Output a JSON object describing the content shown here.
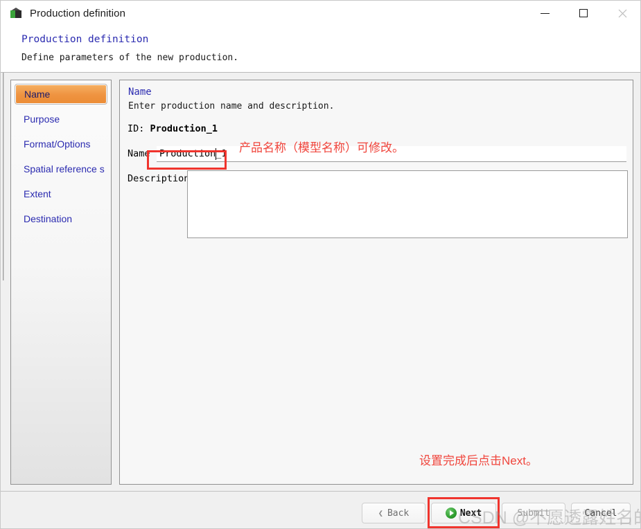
{
  "window": {
    "title": "Production definition",
    "icon": "cube-icon",
    "controls": {
      "minimize": "minimize-icon",
      "maximize": "maximize-icon",
      "close": "close-icon"
    }
  },
  "header": {
    "title": "Production definition",
    "subtitle": "Define parameters of the new production."
  },
  "sidebar": {
    "items": [
      {
        "label": "Name",
        "selected": true
      },
      {
        "label": "Purpose",
        "selected": false
      },
      {
        "label": "Format/Options",
        "selected": false
      },
      {
        "label": "Spatial reference s...",
        "selected": false
      },
      {
        "label": "Extent",
        "selected": false
      },
      {
        "label": "Destination",
        "selected": false
      }
    ]
  },
  "main": {
    "panel_title": "Name",
    "panel_subtitle": "Enter production name and description.",
    "id_label": "ID:",
    "id_value": "Production_1",
    "name_label": "Name",
    "name_value": "Production_1",
    "description_label": "Description",
    "description_value": ""
  },
  "annotations": {
    "name_note": "产品名称（模型名称）可修改。",
    "next_note": "设置完成后点击Next。",
    "highlight_color": "#f0342d"
  },
  "footer": {
    "back": "Back",
    "next": "Next",
    "submit": "Submit",
    "cancel": "Cancel"
  },
  "watermark": {
    "text": "CSDN @不愿透露姓名的美女"
  }
}
